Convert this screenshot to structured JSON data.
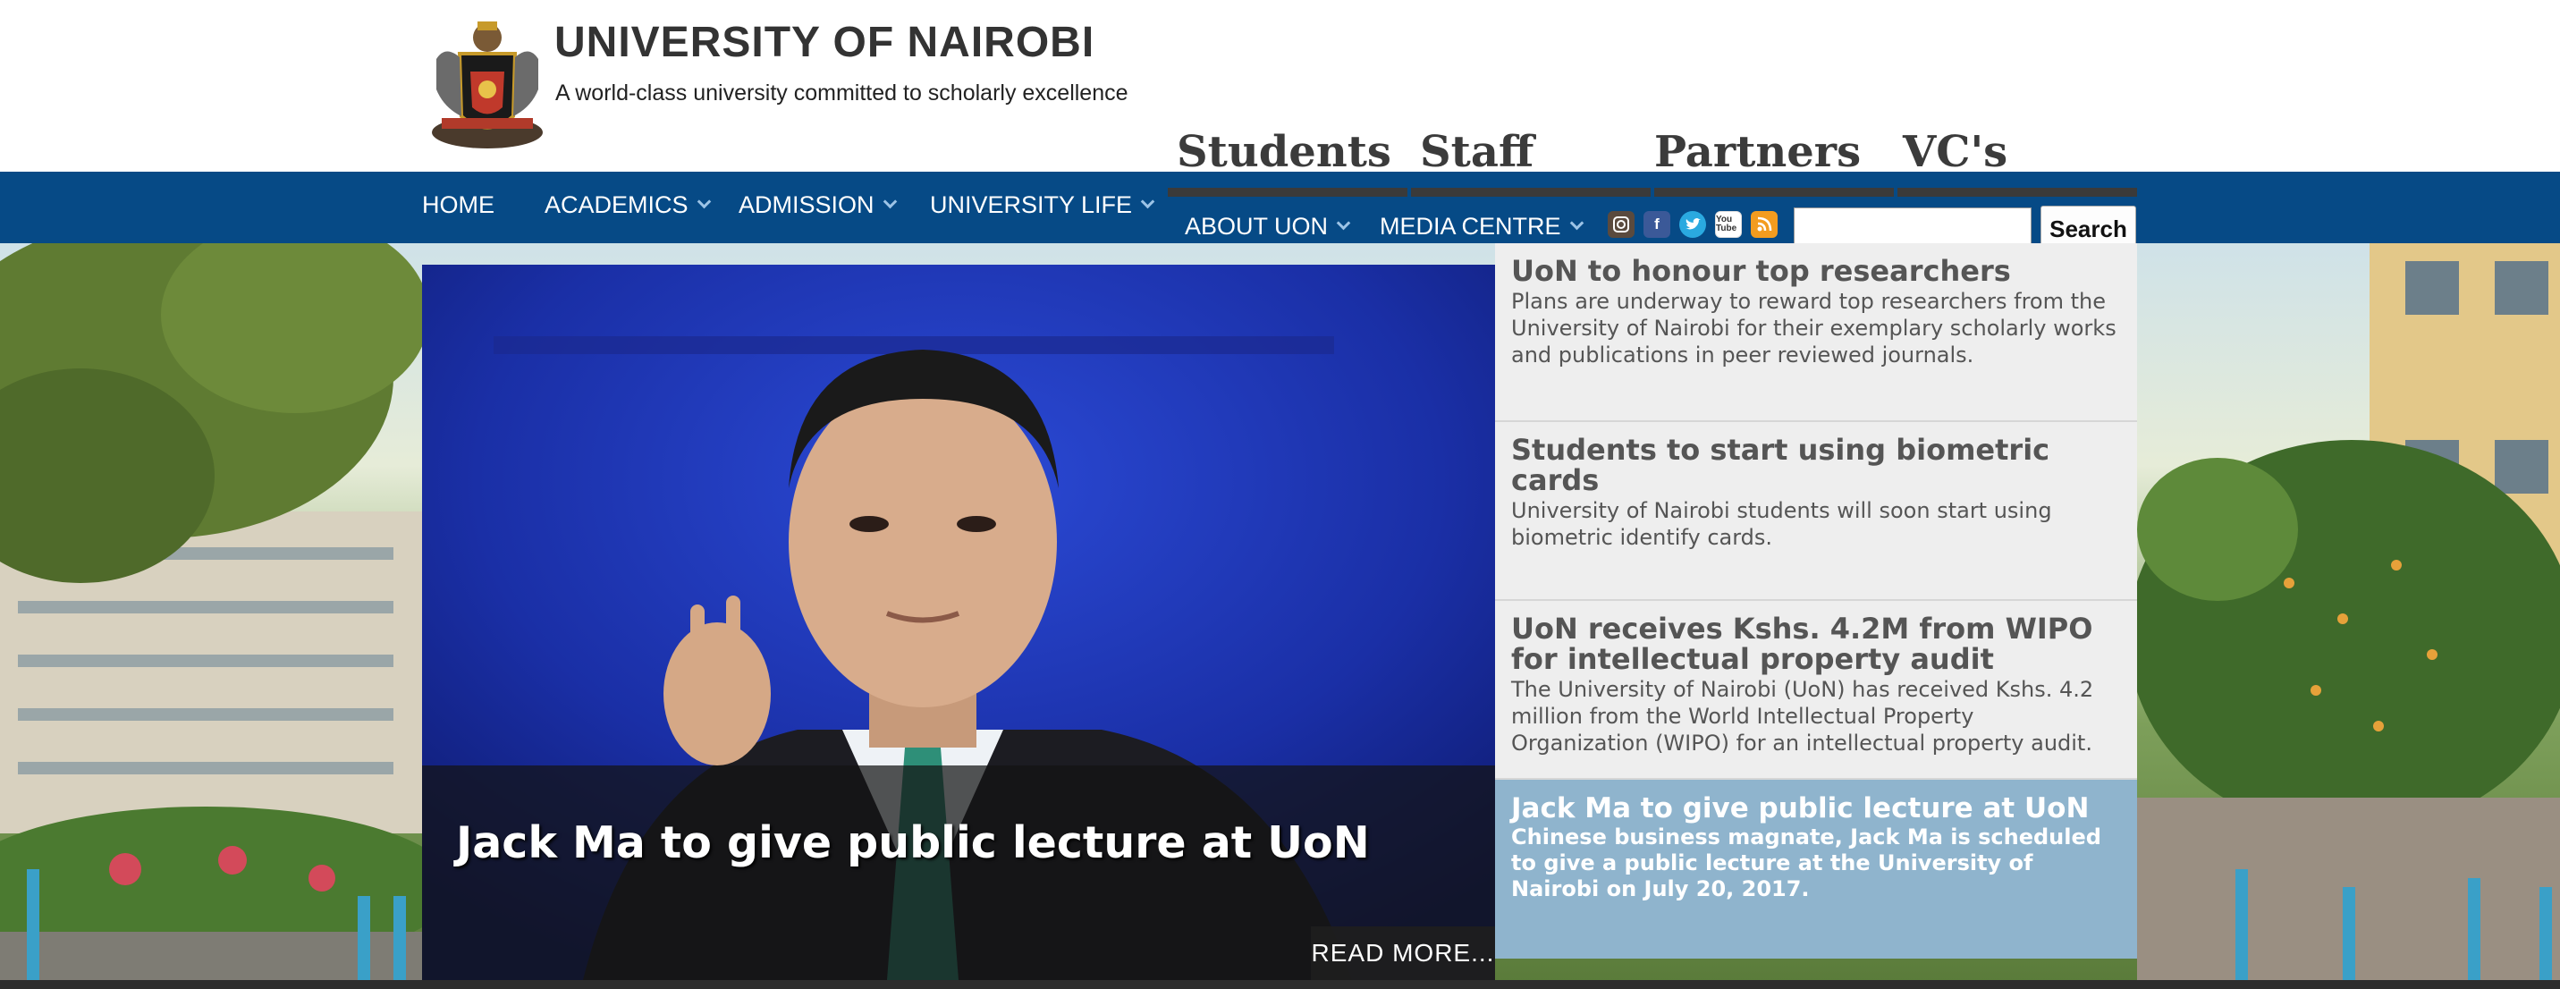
{
  "header": {
    "title": "UNIVERSITY OF NAIROBI",
    "tagline": "A world-class university committed to scholarly excellence"
  },
  "audience_tabs": [
    {
      "label": "Students"
    },
    {
      "label": "Staff"
    },
    {
      "label": "Partners"
    },
    {
      "label": "VC's"
    }
  ],
  "nav": {
    "home": "HOME",
    "academics": "ACADEMICS",
    "admission": "ADMISSION",
    "university_life": "UNIVERSITY LIFE",
    "about": "ABOUT UON",
    "media": "MEDIA CENTRE"
  },
  "social_icons": [
    "instagram-icon",
    "facebook-icon",
    "twitter-icon",
    "youtube-icon",
    "rss-icon"
  ],
  "youtube_text": "You\nTube",
  "search": {
    "placeholder": "",
    "button_label": "Search"
  },
  "slider": {
    "caption_title": "Jack Ma to give public lecture at UoN",
    "read_more": "READ MORE..."
  },
  "news": [
    {
      "title": "UoN to honour top researchers",
      "desc": "Plans are underway to reward top researchers from the University of Nairobi for their exemplary scholarly works and publications in peer reviewed journals."
    },
    {
      "title": "Students to start using biometric cards",
      "desc": "University of Nairobi students will soon start using biometric identify cards."
    },
    {
      "title": "UoN receives Kshs. 4.2M from WIPO for intellectual property audit",
      "desc": "The University of Nairobi (UoN) has received Kshs. 4.2 million from the World Intellectual Property Organization (WIPO) for an intellectual property audit."
    },
    {
      "title": "Jack Ma to give public lecture at UoN",
      "desc": "Chinese business magnate, Jack Ma is scheduled to give a public lecture at the University of Nairobi on July 20, 2017."
    }
  ],
  "colors": {
    "nav_bg": "#064a86",
    "active_news_bg": "#8fb4cd",
    "news_bg": "#eeeeee"
  }
}
